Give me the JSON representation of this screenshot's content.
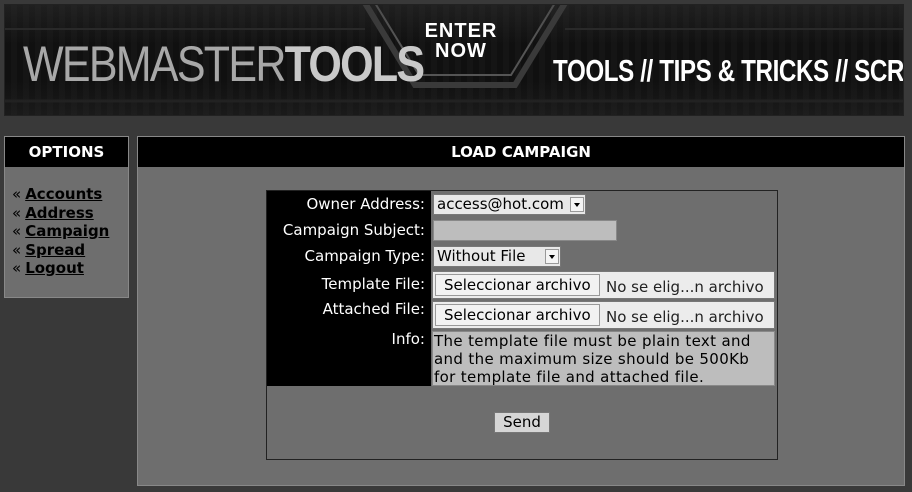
{
  "banner": {
    "logo_light": "WEBMASTER",
    "logo_bold": "TOOLS",
    "enter_line1": "ENTER",
    "enter_line2": "NOW",
    "tagline": "TOOLS // TIPS & TRICKS // SCRIPTS"
  },
  "options": {
    "title": "OPTIONS",
    "bullet": "«",
    "items": [
      {
        "label": "Accounts"
      },
      {
        "label": "Address"
      },
      {
        "label": "Campaign"
      },
      {
        "label": "Spread"
      },
      {
        "label": "Logout"
      }
    ]
  },
  "main": {
    "title": "LOAD CAMPAIGN",
    "form": {
      "owner_address_label": "Owner Address:",
      "owner_address_value": "access@hot.com",
      "subject_label": "Campaign Subject:",
      "subject_value": "",
      "type_label": "Campaign Type:",
      "type_value": "Without File",
      "template_label": "Template File:",
      "template_button": "Seleccionar archivo",
      "template_status": "No se elig...n archivo",
      "attached_label": "Attached File:",
      "attached_button": "Seleccionar archivo",
      "attached_status": "No se elig...n archivo",
      "info_label": "Info:",
      "info_line1": "The template file must be plain text and",
      "info_line2": "and the maximum size should be 500Kb",
      "info_line3": "for template file and attached file.",
      "send_button": "Send"
    }
  }
}
